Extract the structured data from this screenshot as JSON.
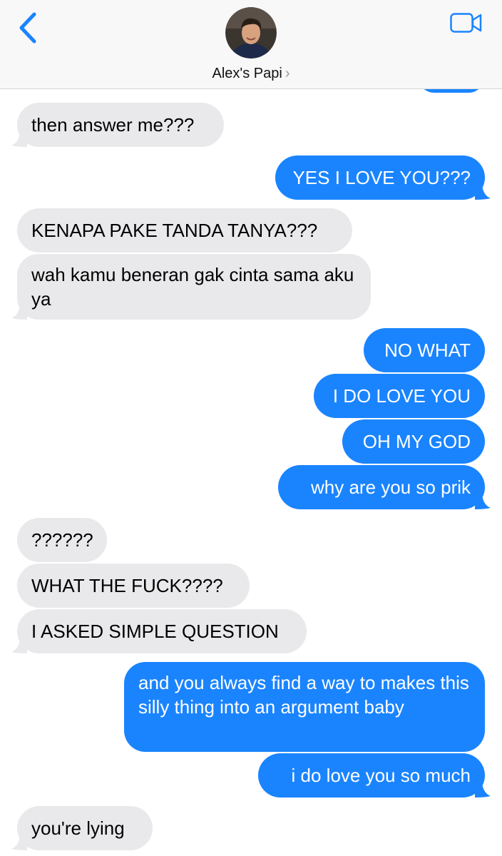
{
  "header": {
    "contact_name": "Alex's Papi",
    "chevron": "›",
    "back_icon": "chevron-left-icon",
    "video_icon": "facetime-video-icon"
  },
  "colors": {
    "outgoing_bubble": "#1a84ff",
    "incoming_bubble": "#e9e9eb",
    "accent": "#1a84ff"
  },
  "messages": [
    {
      "direction": "in",
      "text": "then answer me???"
    },
    {
      "direction": "out",
      "text": "YES I LOVE YOU???"
    },
    {
      "direction": "in",
      "text": "KENAPA PAKE TANDA TANYA???"
    },
    {
      "direction": "in",
      "text": "wah kamu beneran gak cinta sama aku ya"
    },
    {
      "direction": "out",
      "text": "NO WHAT"
    },
    {
      "direction": "out",
      "text": "I DO LOVE YOU"
    },
    {
      "direction": "out",
      "text": "OH MY GOD"
    },
    {
      "direction": "out",
      "text": "why are you so prik"
    },
    {
      "direction": "in",
      "text": "??????"
    },
    {
      "direction": "in",
      "text": "WHAT THE FUCK????"
    },
    {
      "direction": "in",
      "text": "I ASKED SIMPLE QUESTION"
    },
    {
      "direction": "out",
      "text": "and you always find a way to makes this silly thing into an argument baby"
    },
    {
      "direction": "out",
      "text": "i do love you so much"
    },
    {
      "direction": "in",
      "text": "you're lying"
    }
  ]
}
